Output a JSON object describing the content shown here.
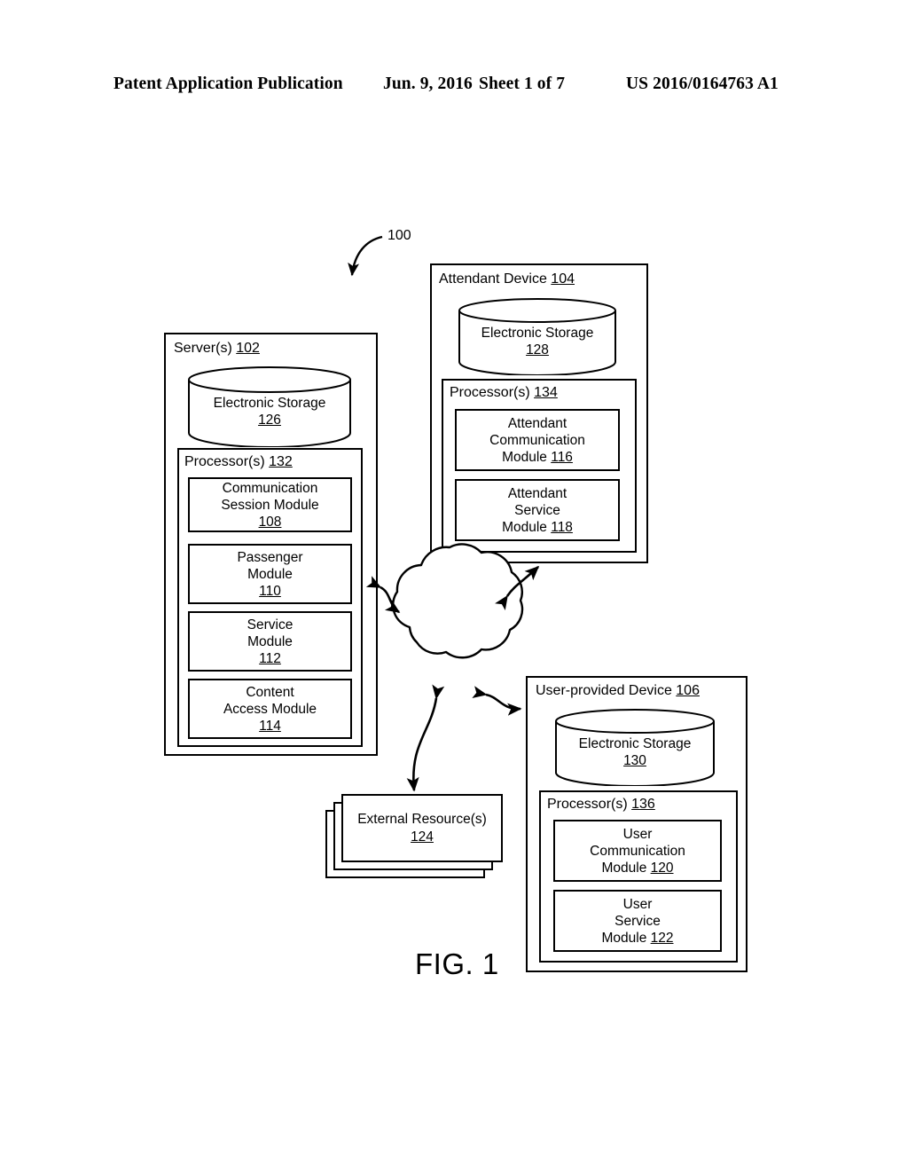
{
  "header": {
    "publication": "Patent Application Publication",
    "date": "Jun. 9, 2016",
    "sheet": "Sheet 1 of 7",
    "patent_number": "US 2016/0164763 A1"
  },
  "figure": {
    "caption": "FIG. 1",
    "system_label": "100",
    "server": {
      "title_text": "Server(s) ",
      "title_ref": "102",
      "storage": {
        "label": "Electronic Storage",
        "ref": "126"
      },
      "processor": {
        "label": "Processor(s) ",
        "ref": "132"
      },
      "modules": [
        {
          "line1": "Communication",
          "line2": "Session Module",
          "ref": "108",
          "ref_inline": false
        },
        {
          "line1": "Passenger",
          "line2": "Module",
          "ref": "110",
          "ref_inline": false
        },
        {
          "line1": "Service",
          "line2": "Module",
          "ref": "112",
          "ref_inline": false
        },
        {
          "line1": "Content",
          "line2": "Access Module",
          "ref": "114",
          "ref_inline": false
        }
      ]
    },
    "attendant_device": {
      "title_text": "Attendant Device ",
      "title_ref": "104",
      "storage": {
        "label": "Electronic Storage",
        "ref": "128"
      },
      "processor": {
        "label": "Processor(s) ",
        "ref": "134"
      },
      "modules": [
        {
          "line1": "Attendant",
          "line2": "Communication",
          "line3": "Module ",
          "ref": "116",
          "ref_inline": true
        },
        {
          "line1": "Attendant",
          "line2": "Service",
          "line3": "Module ",
          "ref": "118",
          "ref_inline": true
        }
      ]
    },
    "user_device": {
      "title_text": "User-provided Device ",
      "title_ref": "106",
      "storage": {
        "label": "Electronic Storage",
        "ref": "130"
      },
      "processor": {
        "label": "Processor(s) ",
        "ref": "136"
      },
      "modules": [
        {
          "line1": "User",
          "line2": "Communication",
          "line3": "Module ",
          "ref": "120",
          "ref_inline": true
        },
        {
          "line1": "User",
          "line2": "Service",
          "line3": "Module ",
          "ref": "122",
          "ref_inline": true
        }
      ]
    },
    "external_resources": {
      "label": "External Resource(s)",
      "ref": "124"
    },
    "network_cloud": {
      "name": "network-cloud",
      "label": ""
    },
    "connections": [
      {
        "from": "server",
        "to": "network-cloud",
        "style": "bidirectional"
      },
      {
        "from": "attendant-device",
        "to": "network-cloud",
        "style": "bidirectional"
      },
      {
        "from": "user-provided-device",
        "to": "network-cloud",
        "style": "bidirectional"
      },
      {
        "from": "external-resources",
        "to": "network-cloud",
        "style": "bidirectional"
      }
    ]
  },
  "colors": {
    "ink": "#000000",
    "paper": "#ffffff"
  }
}
